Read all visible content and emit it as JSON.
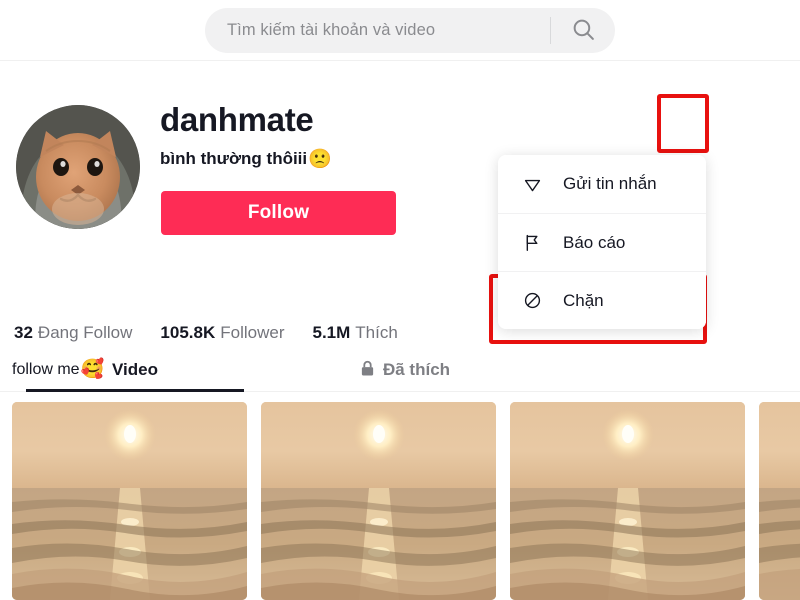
{
  "header": {
    "search": {
      "placeholder": "Tìm kiếm tài khoản và video",
      "value": "",
      "icon": "search-icon"
    }
  },
  "profile": {
    "avatar": {
      "icon": "avatar-cat-hoodie",
      "alt": "cat wearing grey hoodie"
    },
    "username": "danhmate",
    "bio": "bình thường thôiii",
    "bio_emoji": "🙁",
    "follow_button": "Follow",
    "share_icon": "share-arrow-icon",
    "more_icon": "more-options-icon",
    "stats": [
      {
        "value": "32",
        "label": "Đang Follow"
      },
      {
        "value": "105.8K",
        "label": "Follower"
      },
      {
        "value": "5.1M",
        "label": "Thích"
      }
    ],
    "signature": "follow me",
    "signature_emoji": "🥰"
  },
  "dropdown": {
    "items": [
      {
        "label": "Gửi tin nhắn",
        "icon": "send-message-icon",
        "highlighted": false
      },
      {
        "label": "Báo cáo",
        "icon": "flag-report-icon",
        "highlighted": false
      },
      {
        "label": "Chặn",
        "icon": "block-icon",
        "highlighted": true
      }
    ]
  },
  "tabs": [
    {
      "label": "Video",
      "active": true,
      "icon": ""
    },
    {
      "label": "Đã thích",
      "active": false,
      "icon": "lock-icon"
    }
  ],
  "video_grid": {
    "items": [
      {
        "alt": "sunset over ocean"
      },
      {
        "alt": "sunset over ocean"
      },
      {
        "alt": "sunset over ocean"
      },
      {
        "alt": "sunset over ocean"
      }
    ]
  },
  "colors": {
    "brand_pink": "#fe2c55",
    "annotation_red": "#e8110f",
    "text_primary": "#161823",
    "text_secondary": "#73747b",
    "search_bg": "#f1f1f2"
  }
}
